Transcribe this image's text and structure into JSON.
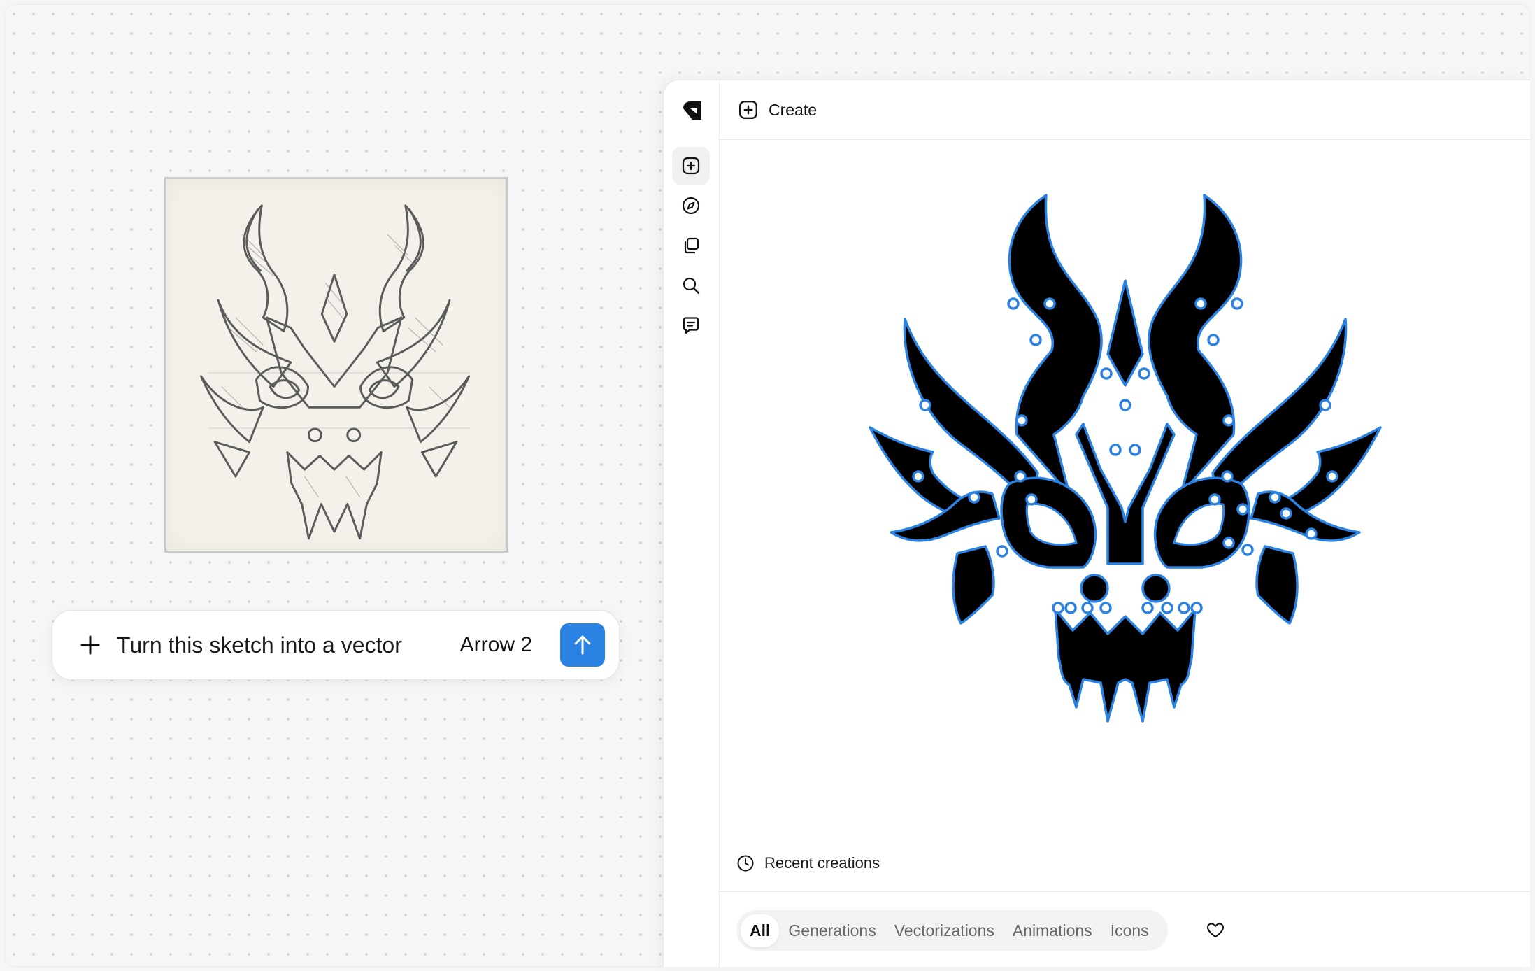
{
  "prompt": {
    "text": "Turn this sketch into a vector",
    "model": "Arrow 2",
    "icons": {
      "add": "plus-icon",
      "send": "arrow-up-icon"
    }
  },
  "header": {
    "title": "Create",
    "icon": "plus-square-icon"
  },
  "rail": {
    "items": [
      {
        "name": "create",
        "icon": "plus-square-icon",
        "active": true
      },
      {
        "name": "explore",
        "icon": "compass-icon",
        "active": false
      },
      {
        "name": "library",
        "icon": "copy-icon",
        "active": false
      },
      {
        "name": "search",
        "icon": "search-icon",
        "active": false
      },
      {
        "name": "chat",
        "icon": "message-icon",
        "active": false
      }
    ]
  },
  "recent": {
    "title": "Recent creations",
    "icon": "clock-icon",
    "filters": [
      "All",
      "Generations",
      "Vectorizations",
      "Animations",
      "Icons"
    ],
    "active_filter": "All",
    "favorite_icon": "heart-icon"
  },
  "colors": {
    "accent": "#2a82e3",
    "vector_outline": "#2a82e3",
    "vector_fill": "#000000"
  }
}
